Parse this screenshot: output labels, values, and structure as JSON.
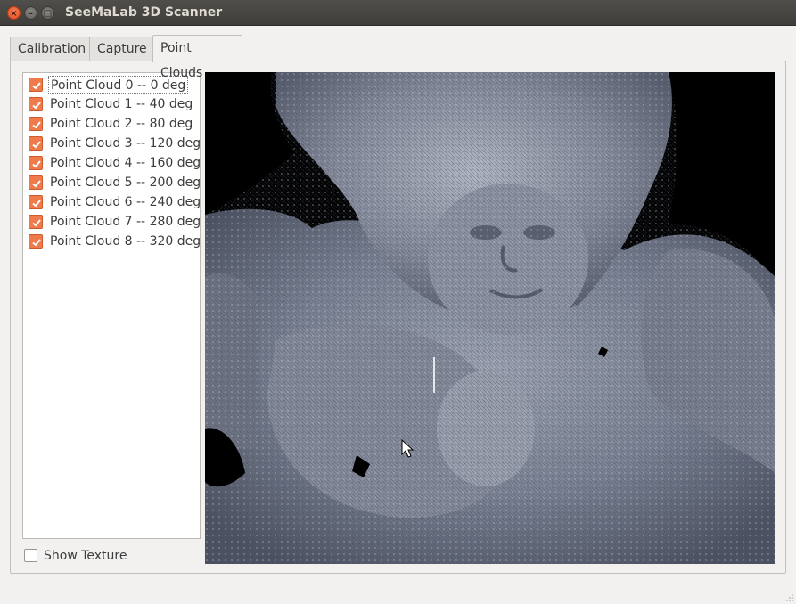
{
  "window": {
    "title": "SeeMaLab 3D Scanner",
    "close_glyph": "×",
    "min_glyph": "–",
    "max_glyph": "□"
  },
  "tabs": [
    {
      "label": "Calibration",
      "active": false
    },
    {
      "label": "Capture",
      "active": false
    },
    {
      "label": "Point Clouds",
      "active": true
    }
  ],
  "point_clouds": [
    {
      "label": "Point Cloud 0 -- 0 deg",
      "checked": true
    },
    {
      "label": "Point Cloud 1 -- 40 deg",
      "checked": true
    },
    {
      "label": "Point Cloud 2 -- 80 deg",
      "checked": true
    },
    {
      "label": "Point Cloud 3 -- 120 deg",
      "checked": true
    },
    {
      "label": "Point Cloud 4 -- 160 deg",
      "checked": true
    },
    {
      "label": "Point Cloud 5 -- 200 deg",
      "checked": true
    },
    {
      "label": "Point Cloud 6 -- 240 deg",
      "checked": true
    },
    {
      "label": "Point Cloud 7 -- 280 deg",
      "checked": true
    },
    {
      "label": "Point Cloud 8 -- 320 deg",
      "checked": true
    }
  ],
  "show_texture": {
    "label": "Show Texture",
    "checked": false
  },
  "colors": {
    "accent_checkbox": "#ef7b4c",
    "titlebar": "#44423e",
    "viewer_background": "#000000",
    "statue_tint": "#7c8394"
  },
  "icons": {
    "close": "close-icon",
    "minimize": "minimize-icon",
    "maximize": "maximize-icon",
    "check": "check-icon",
    "cursor": "mouse-pointer-icon",
    "grip": "resize-grip-icon"
  }
}
